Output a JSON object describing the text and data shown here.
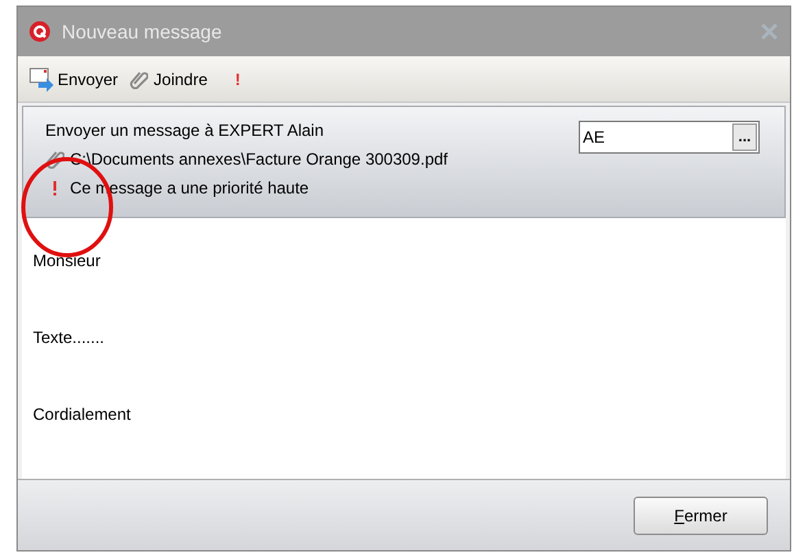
{
  "window": {
    "title": "Nouveau message"
  },
  "toolbar": [
    {
      "kind": "send",
      "label": "Envoyer"
    },
    {
      "kind": "attach",
      "label": "Joindre"
    },
    {
      "kind": "priority",
      "label": "!"
    }
  ],
  "header": {
    "recipient_text": "Envoyer un message à EXPERT Alain",
    "recipient_code": "AE",
    "browse_label": "...",
    "lines": [
      {
        "kind": "attachment",
        "text": "C:\\Documents annexes\\Facture Orange 300309.pdf"
      },
      {
        "kind": "priority",
        "text": "Ce message a une priorité haute"
      }
    ]
  },
  "body": [
    "Monsieur",
    "Texte.......",
    "Cordialement"
  ],
  "footer": {
    "close_button": {
      "label": "Fermer"
    }
  },
  "annotation": {
    "kind": "circle"
  }
}
